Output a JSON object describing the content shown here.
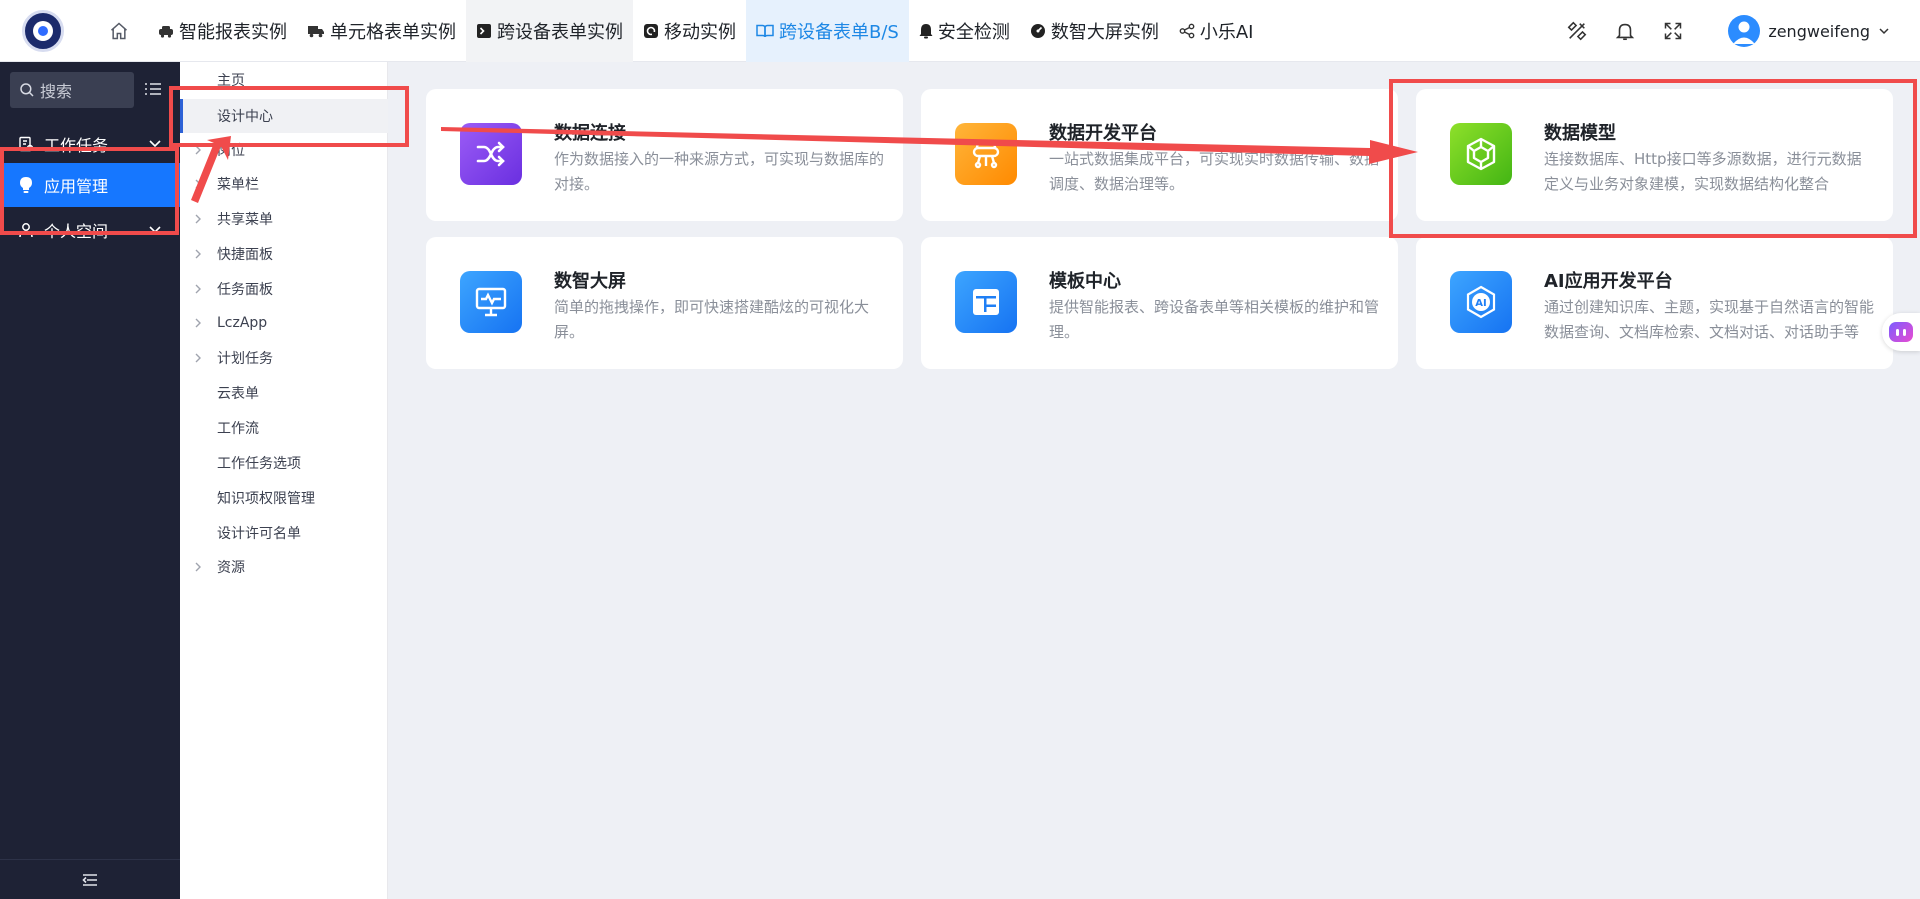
{
  "header": {
    "nav": [
      {
        "label": "智能报表实例",
        "icon": "car-icon"
      },
      {
        "label": "单元格表单实例",
        "icon": "truck-icon"
      },
      {
        "label": "跨设备表单实例",
        "icon": "terminal-icon"
      },
      {
        "label": "移动实例",
        "icon": "app-icon"
      },
      {
        "label": "跨设备表单B/S",
        "icon": "book-icon"
      },
      {
        "label": "安全检测",
        "icon": "bell-icon"
      },
      {
        "label": "数智大屏实例",
        "icon": "dashboard-icon"
      },
      {
        "label": "小乐AI",
        "icon": "share-icon"
      }
    ],
    "user_name": "zengweifeng"
  },
  "sidebar": {
    "search_placeholder": "搜索",
    "items": [
      {
        "label": "工作任务",
        "icon": "task-icon"
      },
      {
        "label": "应用管理",
        "icon": "bulb-icon"
      },
      {
        "label": "个人空间",
        "icon": "user-icon"
      }
    ]
  },
  "tree": {
    "items": [
      {
        "label": "主页"
      },
      {
        "label": "设计中心"
      },
      {
        "label": "岗位"
      },
      {
        "label": "菜单栏"
      },
      {
        "label": "共享菜单"
      },
      {
        "label": "快捷面板"
      },
      {
        "label": "任务面板"
      },
      {
        "label": "LczApp"
      },
      {
        "label": "计划任务"
      },
      {
        "label": "云表单"
      },
      {
        "label": "工作流"
      },
      {
        "label": "工作任务选项"
      },
      {
        "label": "知识项权限管理"
      },
      {
        "label": "设计许可名单"
      },
      {
        "label": "资源"
      }
    ]
  },
  "cards": [
    {
      "title": "数据连接",
      "desc": "作为数据接入的一种来源方式，可实现与数据库的对接。",
      "icon": "shuffle-icon",
      "color": "#7a3df0"
    },
    {
      "title": "数据开发平台",
      "desc": "一站式数据集成平台，可实现实时数据传输、数据调度、数据治理等。",
      "icon": "data-dev-icon",
      "color": "#ff9a1a"
    },
    {
      "title": "数据模型",
      "desc": "连接数据库、Http接口等多源数据，进行元数据定义与业务对象建模，实现数据结构化整合",
      "icon": "cube-icon",
      "color": "#5cc51a"
    },
    {
      "title": "数智大屏",
      "desc": "简单的拖拽操作，即可快速搭建酷炫的可视化大屏。",
      "icon": "screen-icon",
      "color": "#2b8cff"
    },
    {
      "title": "模板中心",
      "desc": "提供智能报表、跨设备表单等相关模板的维护和管理。",
      "icon": "template-icon",
      "color": "#2b8cff"
    },
    {
      "title": "AI应用开发平台",
      "desc": "通过创建知识库、主题，实现基于自然语言的智能数据查询、文档库检索、文档对话、对话助手等",
      "icon": "ai-icon",
      "color": "#2b8cff"
    }
  ],
  "annotation_color": "#f04b4b"
}
